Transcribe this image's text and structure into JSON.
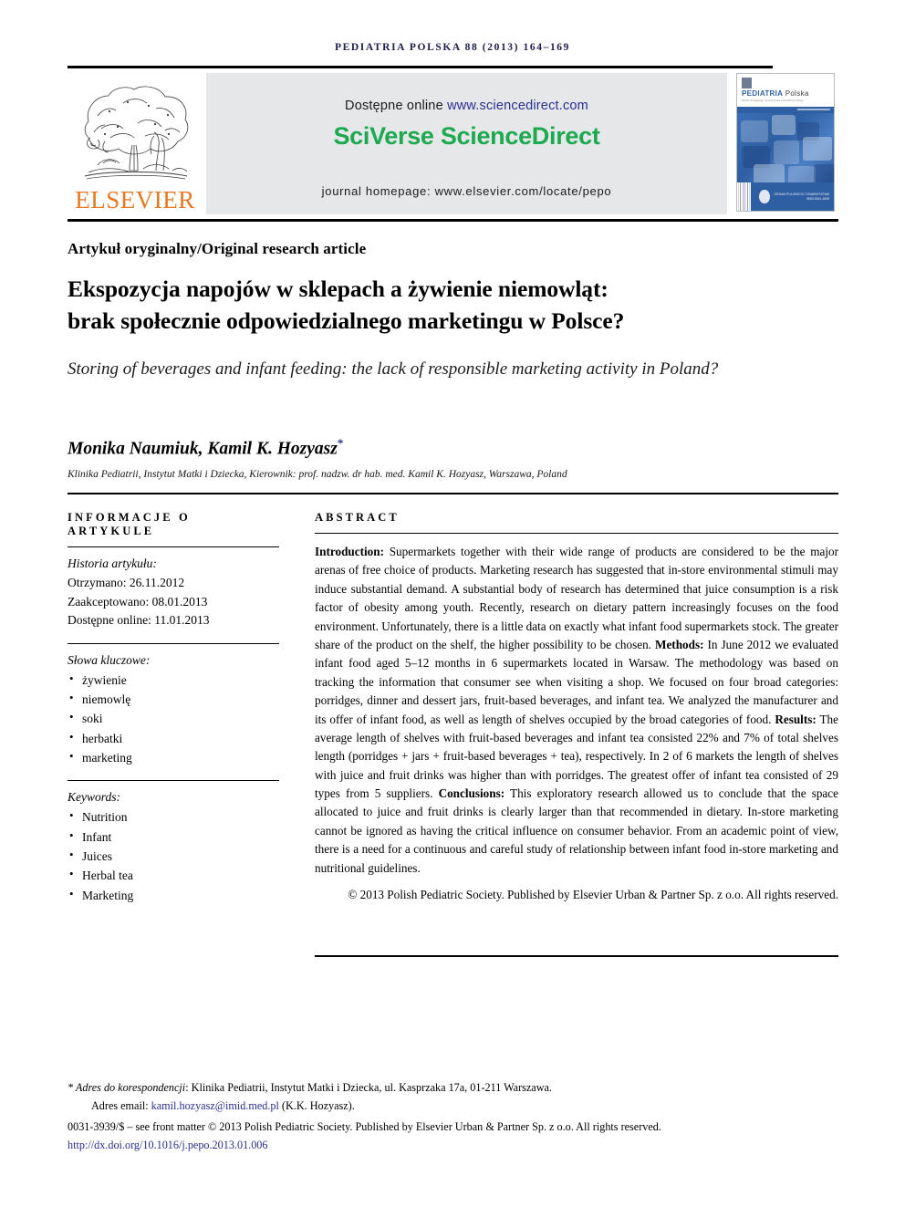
{
  "running_head": "PEDIATRIA POLSKA 88 (2013) 164–169",
  "masthead": {
    "publisher_name": "ELSEVIER",
    "available_prefix": "Dostępne online",
    "available_url": "www.sciencedirect.com",
    "platform_logo": "SciVerse ScienceDirect",
    "homepage_line": "journal homepage: www.elsevier.com/locate/pepo",
    "cover": {
      "title_main": "PEDIATRIA",
      "title_second": "Polska",
      "subtitle": "Pismo Polskiego Towarzystwa Pediatrycznego",
      "footer_text": "ORGAN POLSKIEGO TOWARZYSTWA\nISSN 0031-3939"
    },
    "accent_green": "#1DA94F",
    "accent_orange": "#E87722",
    "link_blue": "#2b2f8f",
    "banner_grey": "#e6e7e8"
  },
  "article_type": "Artykuł oryginalny/Original research article",
  "title_pl_line1": "Ekspozycja napojów w sklepach a żywienie niemowląt:",
  "title_pl_line2": "brak społecznie odpowiedzialnego marketingu w Polsce?",
  "title_en": "Storing of beverages and infant feeding: the lack of responsible marketing activity in Poland?",
  "authors": "Monika Naumiuk, Kamil K. Hozyasz",
  "author_marker": "*",
  "affiliation": "Klinika Pediatrii, Instytut Matki i Dziecka, Kierownik: prof. nadzw. dr hab. med. Kamil K. Hozyasz, Warszawa, Poland",
  "info": {
    "section_heading": "INFORMACJE O ARTYKULE",
    "history_label": "Historia artykułu:",
    "history": [
      "Otrzymano: 26.11.2012",
      "Zaakceptowano: 08.01.2013",
      "Dostępne online: 11.01.2013"
    ],
    "keywords_pl_label": "Słowa kluczowe:",
    "keywords_pl": [
      "żywienie",
      "niemowlę",
      "soki",
      "herbatki",
      "marketing"
    ],
    "keywords_en_label": "Keywords:",
    "keywords_en": [
      "Nutrition",
      "Infant",
      "Juices",
      "Herbal tea",
      "Marketing"
    ]
  },
  "abstract": {
    "section_heading": "ABSTRACT",
    "label_introduction": "Introduction:",
    "text_introduction": " Supermarkets together with their wide range of products are considered to be the major arenas of free choice of products. Marketing research has suggested that in-store environmental stimuli may induce substantial demand. A substantial body of research has determined that juice consumption is a risk factor of obesity among youth. Recently, research on dietary pattern increasingly focuses on the food environment. Unfortunately, there is a little data on exactly what infant food supermarkets stock. The greater share of the product on the shelf, the higher possibility to be chosen. ",
    "label_methods": "Methods:",
    "text_methods": " In June 2012 we evaluated infant food aged 5–12 months in 6 supermarkets located in Warsaw. The methodology was based on tracking the information that consumer see when visiting a shop. We focused on four broad categories: porridges, dinner and dessert jars, fruit-based beverages, and infant tea. We analyzed the manufacturer and its offer of infant food, as well as length of shelves occupied by the broad categories of food. ",
    "label_results": "Results:",
    "text_results": " The average length of shelves with fruit-based beverages and infant tea consisted 22% and 7% of total shelves length (porridges + jars + fruit-based beverages + tea), respectively. In 2 of 6 markets the length of shelves with juice and fruit drinks was higher than with porridges. The greatest offer of infant tea consisted of 29 types from 5 suppliers. ",
    "label_conclusions": "Conclusions:",
    "text_conclusions": " This exploratory research allowed us to conclude that the space allocated to juice and fruit drinks is clearly larger than that recommended in dietary. In-store marketing cannot be ignored as having the critical influence on consumer behavior. From an academic point of view, there is a need for a continuous and careful study of relationship between infant food in-store marketing and nutritional guidelines.",
    "copyright": "© 2013 Polish Pediatric Society. Published by Elsevier Urban & Partner Sp. z o.o. All rights reserved."
  },
  "footer": {
    "corr_marker": "*",
    "corr_label": "Adres do korespondencji",
    "corr_address": ": Klinika Pediatrii, Instytut Matki i Dziecka, ul. Kasprzaka 17a, 01-211 Warszawa.",
    "email_label": "Adres email:",
    "email": "kamil.hozyasz@imid.med.pl",
    "email_suffix": "(K.K. Hozyasz).",
    "front_matter": "0031-3939/$ – see front matter © 2013 Polish Pediatric Society. Published by Elsevier Urban & Partner Sp. z o.o. All rights reserved.",
    "doi": "http://dx.doi.org/10.1016/j.pepo.2013.01.006"
  }
}
